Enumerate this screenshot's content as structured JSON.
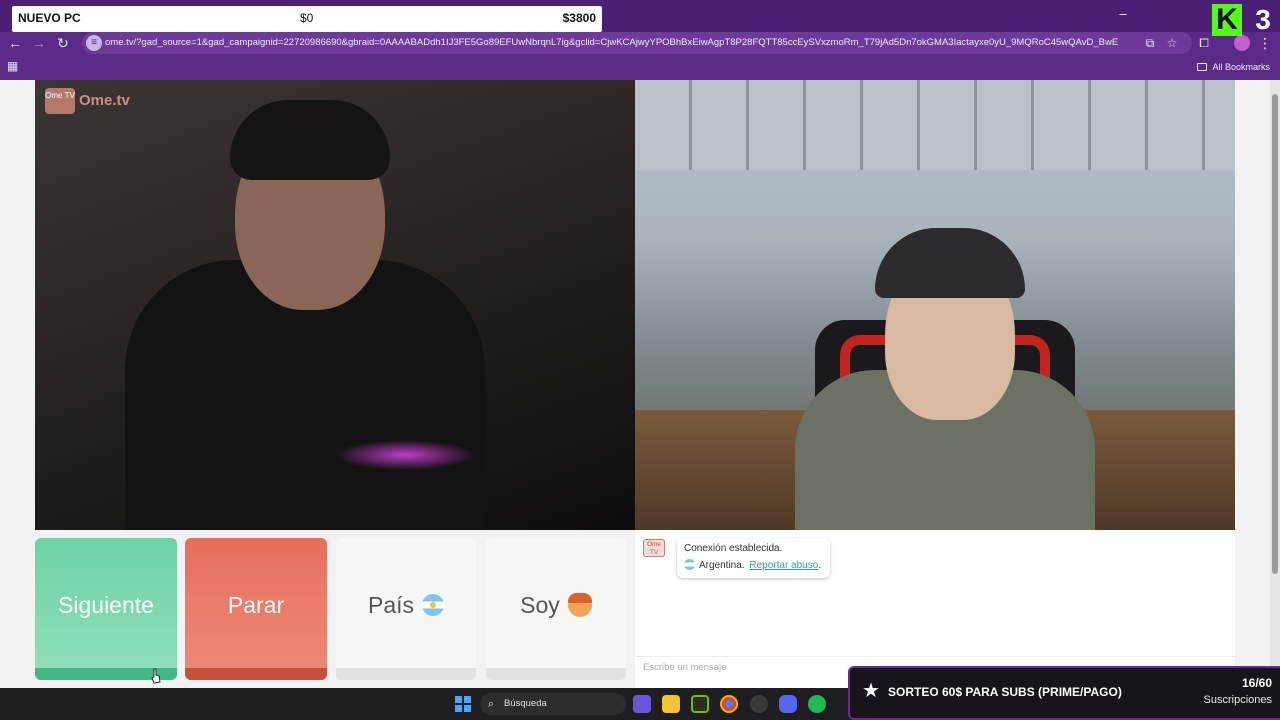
{
  "overlay": {
    "pc_title": "NUEVO PC",
    "pc_current": "$0",
    "pc_goal": "$3800",
    "kick_number": "3"
  },
  "browser": {
    "url": "ome.tv/?gad_source=1&gad_campaignid=22720986690&gbraid=0AAAABADdh1IJ3FE5Go89EFUwNbrqnL7ig&gclid=CjwKCAjwyYPOBhBxEiwAgpT8P28FQTT85ccEySVxzmoRm_T79jAd5Dn7okGMA3Iactayxe0yU_9MQRoC45wQAvD_BwE",
    "bookmarks_label": "All Bookmarks"
  },
  "ome": {
    "logo_text": "Ome.tv",
    "logo_box": "Ome TV",
    "buttons": {
      "next": "Siguiente",
      "stop": "Parar",
      "country": "País",
      "gender": "Soy"
    },
    "chat": {
      "avatar": "Ome TV",
      "line1": "Conexión establecida.",
      "country": "Argentina.",
      "report": "Reportar abuso",
      "report_suffix": ".",
      "input_placeholder": "Escribe un mensaje"
    }
  },
  "taskbar": {
    "search_placeholder": "Búsqueda"
  },
  "stream_overlay": {
    "title": "SORTEO 60$ PARA SUBS (PRIME/PAGO)",
    "count": "16/60",
    "subs_label": "Suscripciones"
  },
  "colors": {
    "browser_frame": "#5b2a86",
    "next_button": "#6ed3a4",
    "stop_button": "#e86f5c",
    "kick_green": "#53fc18"
  }
}
